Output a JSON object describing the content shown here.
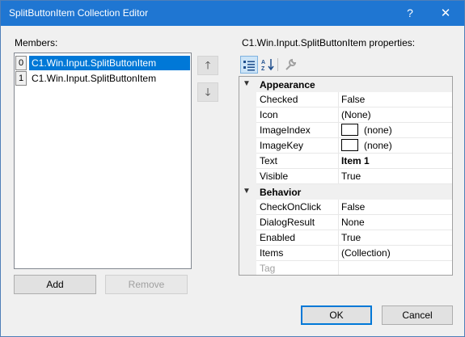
{
  "window": {
    "title": "SplitButtonItem Collection Editor",
    "help_glyph": "?",
    "close_glyph": "✕"
  },
  "members": {
    "label": "Members:",
    "items": [
      {
        "index": "0",
        "text": "C1.Win.Input.SplitButtonItem",
        "selected": true
      },
      {
        "index": "1",
        "text": "C1.Win.Input.SplitButtonItem",
        "selected": false
      }
    ],
    "move_up_glyph": "🡑",
    "move_down_glyph": "🡓",
    "add_label": "Add",
    "remove_label": "Remove"
  },
  "properties": {
    "label": "C1.Win.Input.SplitButtonItem properties:",
    "categories": [
      {
        "name": "Appearance",
        "props": [
          {
            "name": "Checked",
            "value": "False"
          },
          {
            "name": "Icon",
            "value": "(None)"
          },
          {
            "name": "ImageIndex",
            "value": "(none)",
            "swatch": true
          },
          {
            "name": "ImageKey",
            "value": "(none)",
            "swatch": true
          },
          {
            "name": "Text",
            "value": "Item 1",
            "bold": true
          },
          {
            "name": "Visible",
            "value": "True"
          }
        ]
      },
      {
        "name": "Behavior",
        "props": [
          {
            "name": "CheckOnClick",
            "value": "False"
          },
          {
            "name": "DialogResult",
            "value": "None"
          },
          {
            "name": "Enabled",
            "value": "True"
          },
          {
            "name": "Items",
            "value": "(Collection)"
          },
          {
            "name": "Tag",
            "value": "",
            "disabled": true
          }
        ]
      }
    ]
  },
  "footer": {
    "ok_label": "OK",
    "cancel_label": "Cancel"
  }
}
